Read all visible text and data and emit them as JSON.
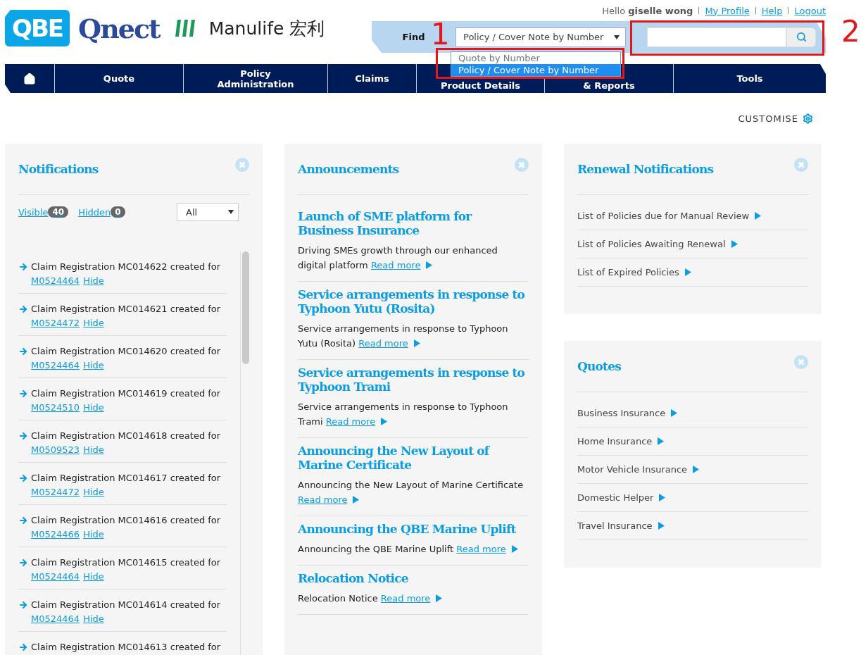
{
  "header": {
    "logos": {
      "qbe": "QBE",
      "qnect": "Qnect",
      "manulife": "Manulife",
      "manulife_cn": "宏利"
    },
    "greeting": "Hello",
    "user": "giselle wong",
    "links": [
      "My Profile",
      "Help",
      "Logout"
    ]
  },
  "find": {
    "label": "Find",
    "select_value": "Policy / Cover Note by Number",
    "options": [
      {
        "label": "Quote by Number",
        "selected": false
      },
      {
        "label": "Policy / Cover Note by Number",
        "selected": true
      }
    ]
  },
  "nav": [
    {
      "kind": "home"
    },
    {
      "kind": "text",
      "lines": [
        "Quote"
      ]
    },
    {
      "kind": "text",
      "lines": [
        "Policy",
        "Administration"
      ]
    },
    {
      "kind": "text",
      "lines": [
        "Claims"
      ]
    },
    {
      "kind": "text",
      "lines": [
        "Product Details"
      ]
    },
    {
      "kind": "text",
      "lines": [
        "& Reports"
      ]
    },
    {
      "kind": "text",
      "lines": [
        "Tools"
      ]
    }
  ],
  "customise": "CUSTOMISE",
  "notifications": {
    "title": "Notifications",
    "tabs": [
      {
        "label": "Visible",
        "count": "40"
      },
      {
        "label": "Hidden",
        "count": "0"
      }
    ],
    "filter": "All",
    "items": [
      {
        "text": "Claim Registration MC014622 created for",
        "policy": "M0524464",
        "hide": "Hide"
      },
      {
        "text": "Claim Registration MC014621 created for",
        "policy": "M0524472",
        "hide": "Hide"
      },
      {
        "text": "Claim Registration MC014620 created for",
        "policy": "M0524464",
        "hide": "Hide"
      },
      {
        "text": "Claim Registration MC014619 created for",
        "policy": "M0524510",
        "hide": "Hide"
      },
      {
        "text": "Claim Registration MC014618 created for",
        "policy": "M0509523",
        "hide": "Hide"
      },
      {
        "text": "Claim Registration MC014617 created for",
        "policy": "M0524472",
        "hide": "Hide"
      },
      {
        "text": "Claim Registration MC014616 created for",
        "policy": "M0524466",
        "hide": "Hide"
      },
      {
        "text": "Claim Registration MC014615 created for",
        "policy": "M0524464",
        "hide": "Hide"
      },
      {
        "text": "Claim Registration MC014614 created for",
        "policy": "M0524464",
        "hide": "Hide"
      },
      {
        "text": "Claim Registration MC014613 created for"
      }
    ]
  },
  "announcements": {
    "title": "Announcements",
    "items": [
      {
        "title": "Launch of SME platform for Business Insurance",
        "text": "Driving SMEs growth through our enhanced digital platform",
        "link": "Read more"
      },
      {
        "title": "Service arrangements in response to Typhoon Yutu (Rosita)",
        "text": "Service arrangements in response to Typhoon Yutu (Rosita)",
        "link": "Read more"
      },
      {
        "title": "Service arrangements in response to Typhoon Trami",
        "text": "Service arrangements in response to Typhoon Trami",
        "link": "Read more"
      },
      {
        "title": "Announcing the New Layout of Marine Certificate",
        "text": "Announcing the New Layout of Marine Certificate",
        "link": "Read more"
      },
      {
        "title": "Announcing the QBE Marine Uplift",
        "text": "Announcing the QBE Marine Uplift",
        "link": "Read more"
      },
      {
        "title": "Relocation Notice",
        "text": "Relocation Notice",
        "link": "Read more"
      }
    ]
  },
  "renewal": {
    "title": "Renewal Notifications",
    "links": [
      "List of Policies due for Manual Review",
      "List of Policies Awaiting Renewal",
      "List of Expired Policies"
    ]
  },
  "quotes": {
    "title": "Quotes",
    "links": [
      "Business Insurance",
      "Home Insurance",
      "Motor Vehicle Insurance",
      "Domestic Helper",
      "Travel Insurance"
    ]
  },
  "annotations": [
    {
      "label": "1"
    },
    {
      "label": "2"
    }
  ]
}
